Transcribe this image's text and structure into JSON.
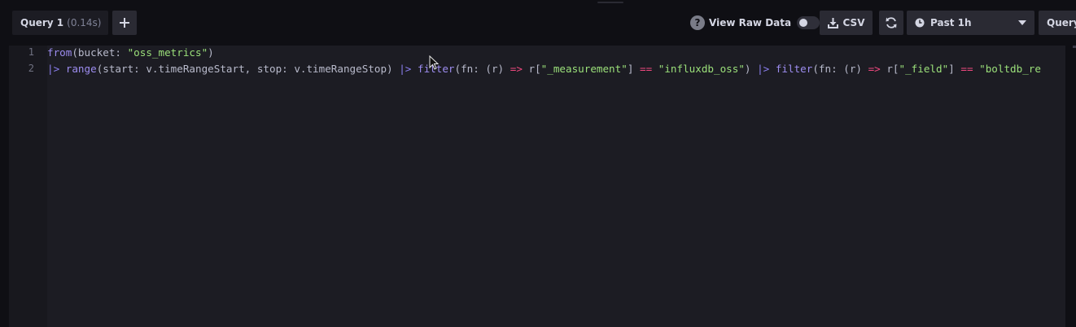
{
  "toolbar": {
    "query_tab": {
      "name": "Query 1",
      "timing": "(0.14s)"
    },
    "add_query_label": "+",
    "view_raw_data": {
      "help_icon": "?",
      "label": "View Raw Data",
      "enabled": false
    },
    "csv_label": "CSV",
    "time_range": {
      "label": "Past 1h"
    },
    "query_builder_label": "Query"
  },
  "editor": {
    "line_numbers": [
      "1",
      "2"
    ],
    "lines": [
      [
        {
          "t": "from",
          "c": "fn"
        },
        {
          "t": "(bucket: ",
          "c": "ident"
        },
        {
          "t": "\"oss_metrics\"",
          "c": "str"
        },
        {
          "t": ")",
          "c": "ident"
        }
      ],
      [
        {
          "t": "|>",
          "c": "op"
        },
        {
          "t": " ",
          "c": "ident"
        },
        {
          "t": "range",
          "c": "fn"
        },
        {
          "t": "(start: v.timeRangeStart, stop: v.timeRangeStop) ",
          "c": "ident"
        },
        {
          "t": "|>",
          "c": "op"
        },
        {
          "t": " ",
          "c": "ident"
        },
        {
          "t": "filter",
          "c": "fn"
        },
        {
          "t": "(fn: (r) ",
          "c": "ident"
        },
        {
          "t": "=>",
          "c": "arrow"
        },
        {
          "t": " r[",
          "c": "ident"
        },
        {
          "t": "\"_measurement\"",
          "c": "str"
        },
        {
          "t": "] ",
          "c": "ident"
        },
        {
          "t": "==",
          "c": "arrow"
        },
        {
          "t": " ",
          "c": "ident"
        },
        {
          "t": "\"influxdb_oss\"",
          "c": "str"
        },
        {
          "t": ") ",
          "c": "ident"
        },
        {
          "t": "|>",
          "c": "op"
        },
        {
          "t": " ",
          "c": "ident"
        },
        {
          "t": "filter",
          "c": "fn"
        },
        {
          "t": "(fn: (r) ",
          "c": "ident"
        },
        {
          "t": "=>",
          "c": "arrow"
        },
        {
          "t": " r[",
          "c": "ident"
        },
        {
          "t": "\"_field\"",
          "c": "str"
        },
        {
          "t": "] ",
          "c": "ident"
        },
        {
          "t": "==",
          "c": "arrow"
        },
        {
          "t": " ",
          "c": "ident"
        },
        {
          "t": "\"boltdb_re",
          "c": "str"
        }
      ]
    ]
  },
  "colors": {
    "background": "#0f0f14",
    "editor_bg": "#1c1c23",
    "function": "#9d8df0",
    "pipe_operator": "#8b7ff0",
    "string": "#9be07a",
    "arrow_operator": "#f0487f"
  },
  "icons": {
    "add": "plus-icon",
    "help": "help-icon",
    "csv": "download-icon",
    "refresh": "refresh-icon",
    "time": "clock-icon",
    "dropdown": "caret-down-icon",
    "pointer": "mouse-cursor-icon"
  }
}
